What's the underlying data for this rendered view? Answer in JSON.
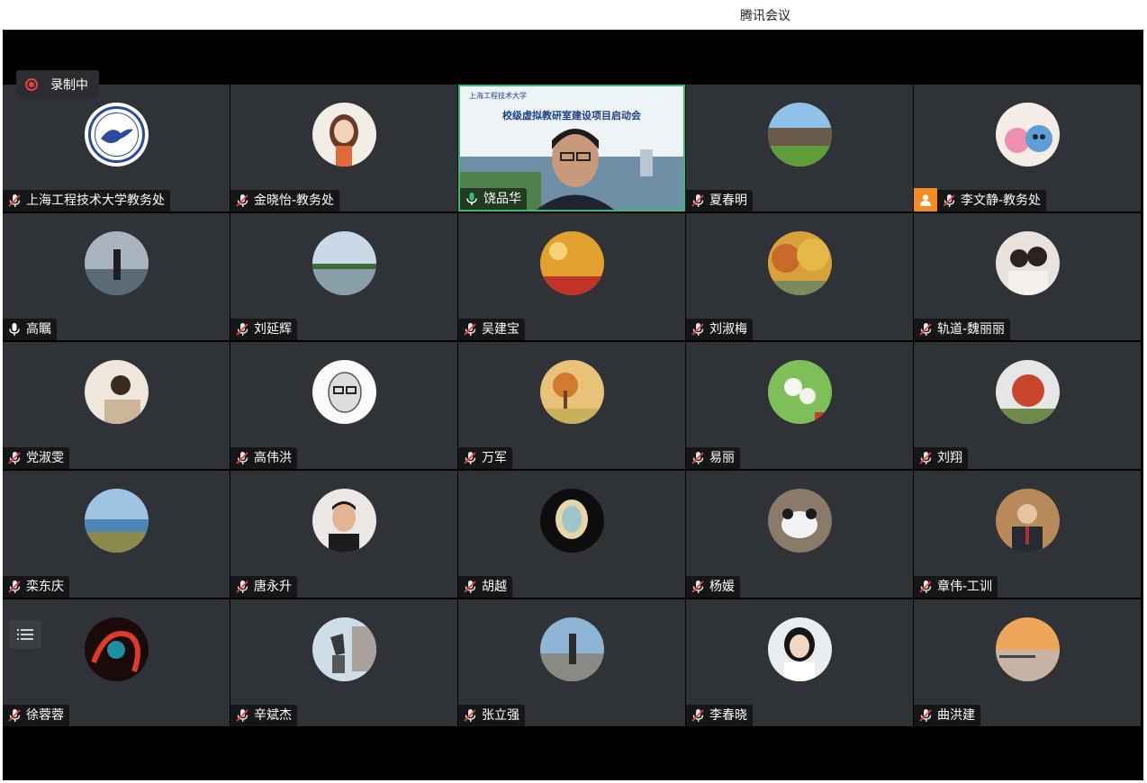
{
  "window": {
    "title": "腾讯会议"
  },
  "recording": {
    "label": "录制中"
  },
  "presenter": {
    "slide_title": "校级虚拟教研室建设项目启动会",
    "slide_logo": "上海工程技术大学"
  },
  "colors": {
    "tile_bg": "#2f3236",
    "active_border": "#2fbf7a",
    "record_red": "#e8413d",
    "host_orange": "#f58a1f"
  },
  "participants": [
    {
      "name": "上海工程技术大学教务处",
      "mic": "muted",
      "avatar": "school-logo"
    },
    {
      "name": "金晓怡-教务处",
      "mic": "muted",
      "avatar": "cartoon-woman"
    },
    {
      "name": "饶品华",
      "mic": "active",
      "avatar": "video"
    },
    {
      "name": "夏春明",
      "mic": "muted",
      "avatar": "building-lawn"
    },
    {
      "name": "李文静-教务处",
      "mic": "muted",
      "avatar": "plush-toys",
      "host": true
    },
    {
      "name": "高瞩",
      "mic": "on",
      "avatar": "person-coast"
    },
    {
      "name": "刘延辉",
      "mic": "muted",
      "avatar": "lake-sky"
    },
    {
      "name": "吴建宝",
      "mic": "muted",
      "avatar": "golden-field"
    },
    {
      "name": "刘淑梅",
      "mic": "muted",
      "avatar": "autumn-trees"
    },
    {
      "name": "轨道-魏丽丽",
      "mic": "muted",
      "avatar": "mother-child"
    },
    {
      "name": "党淑雯",
      "mic": "muted",
      "avatar": "woman-portrait"
    },
    {
      "name": "高伟洪",
      "mic": "muted",
      "avatar": "sketch-man"
    },
    {
      "name": "万军",
      "mic": "muted",
      "avatar": "autumn-cartoon"
    },
    {
      "name": "易丽",
      "mic": "muted",
      "avatar": "white-flowers"
    },
    {
      "name": "刘翔",
      "mic": "muted",
      "avatar": "red-tree"
    },
    {
      "name": "栾东庆",
      "mic": "muted",
      "avatar": "sea-horizon"
    },
    {
      "name": "唐永升",
      "mic": "muted",
      "avatar": "man-portrait"
    },
    {
      "name": "胡越",
      "mic": "muted",
      "avatar": "ornate-chair"
    },
    {
      "name": "杨媛",
      "mic": "muted",
      "avatar": "panda-toy"
    },
    {
      "name": "章伟-工训",
      "mic": "muted",
      "avatar": "man-suit"
    },
    {
      "name": "徐蓉蓉",
      "mic": "muted",
      "avatar": "neon-art"
    },
    {
      "name": "辛斌杰",
      "mic": "muted",
      "avatar": "statue"
    },
    {
      "name": "张立强",
      "mic": "muted",
      "avatar": "person-harbor"
    },
    {
      "name": "李春晓",
      "mic": "muted",
      "avatar": "woman-glasses"
    },
    {
      "name": "曲洪建",
      "mic": "muted",
      "avatar": "sunset-pier"
    }
  ]
}
